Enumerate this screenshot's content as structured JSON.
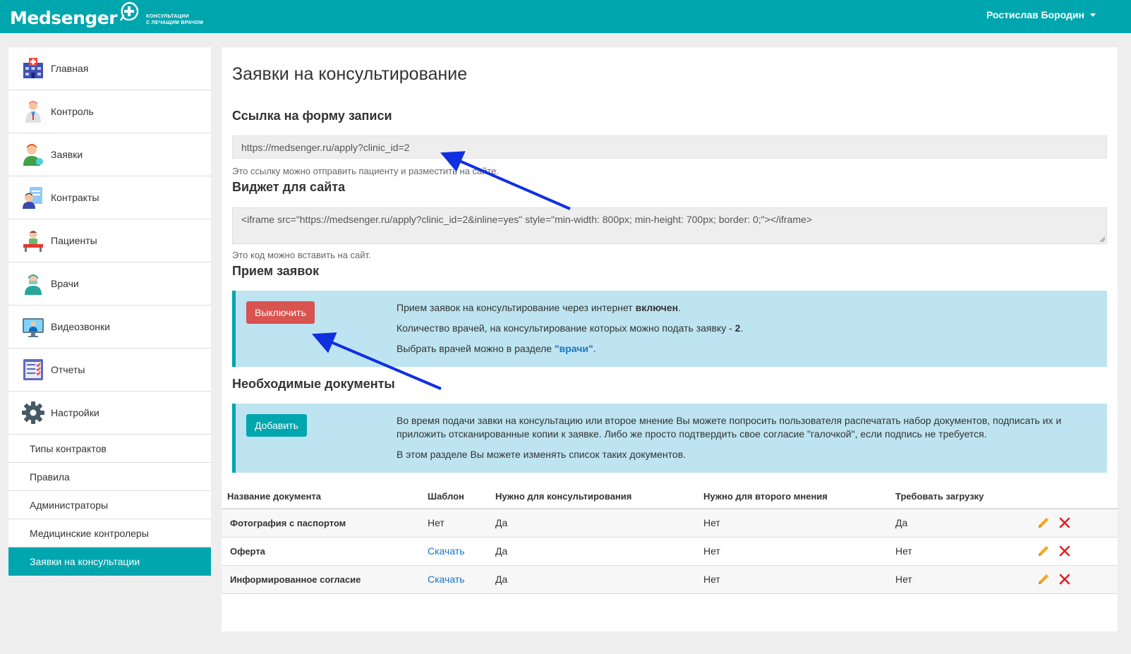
{
  "header": {
    "logo_text": "Medsenger",
    "tagline_line1": "консультации",
    "tagline_line2": "с лечащим врачом",
    "user_name": "Ростислав Бородин",
    "brand_color": "#00a6ae"
  },
  "sidebar": {
    "items": [
      {
        "label": "Главная",
        "icon": "hospital-icon"
      },
      {
        "label": "Контроль",
        "icon": "doctor-icon"
      },
      {
        "label": "Заявки",
        "icon": "user-icon"
      },
      {
        "label": "Контракты",
        "icon": "contract-icon"
      },
      {
        "label": "Пациенты",
        "icon": "patient-icon"
      },
      {
        "label": "Врачи",
        "icon": "surgeon-icon"
      },
      {
        "label": "Видеозвонки",
        "icon": "video-call-icon"
      },
      {
        "label": "Отчеты",
        "icon": "report-icon"
      },
      {
        "label": "Настройки",
        "icon": "gear-icon"
      }
    ],
    "subitems": [
      {
        "label": "Типы контрактов"
      },
      {
        "label": "Правила"
      },
      {
        "label": "Администраторы"
      },
      {
        "label": "Медицинские контролеры"
      },
      {
        "label": "Заявки на консультации",
        "active": true
      }
    ]
  },
  "main": {
    "title": "Заявки на консультирование",
    "link_section": {
      "heading": "Ссылка на форму записи",
      "url": "https://medsenger.ru/apply?clinic_id=2",
      "help": "Это ссылку можно отправить пациенту и разместить на сайте."
    },
    "widget_section": {
      "heading": "Виджет для сайта",
      "code": "<iframe src=\"https://medsenger.ru/apply?clinic_id=2&inline=yes\" style=\"min-width: 800px; min-height: 700px; border: 0;\"></iframe>",
      "help": "Это код можно вставить на сайт."
    },
    "accept_section": {
      "heading": "Прием заявок",
      "button_label": "Выключить",
      "line1_prefix": "Прием заявок на консультирование через интернет ",
      "line1_bold": "включен",
      "line1_suffix": ".",
      "line2_prefix": "Количество врачей, на консультирование которых можно подать заявку - ",
      "line2_bold": "2",
      "line2_suffix": ".",
      "line3_prefix": "Выбрать врачей можно в разделе ",
      "line3_link": "\"врачи\"",
      "line3_suffix": "."
    },
    "docs_section": {
      "heading": "Необходимые документы",
      "button_label": "Добавить",
      "para1": "Во время подачи завки на консультацию или второе мнение Вы можете попросить пользователя распечатать набор документов, подписать их и приложить отсканированные копии к заявке. Либо же просто подтвердить свое согласие \"галочкой\", если подпись не требуется.",
      "para2": "В этом разделе Вы можете изменять список таких документов."
    },
    "table": {
      "headers": [
        "Название документа",
        "Шаблон",
        "Нужно для консультирования",
        "Нужно для второго мнения",
        "Требовать загрузку"
      ],
      "rows": [
        {
          "name": "Фотография с паспортом",
          "template": "Нет",
          "template_link": false,
          "consult": "Да",
          "second": "Нет",
          "upload": "Да"
        },
        {
          "name": "Оферта",
          "template": "Скачать",
          "template_link": true,
          "consult": "Да",
          "second": "Нет",
          "upload": "Нет"
        },
        {
          "name": "Информированное согласие",
          "template": "Скачать",
          "template_link": true,
          "consult": "Да",
          "second": "Нет",
          "upload": "Нет"
        }
      ]
    }
  }
}
